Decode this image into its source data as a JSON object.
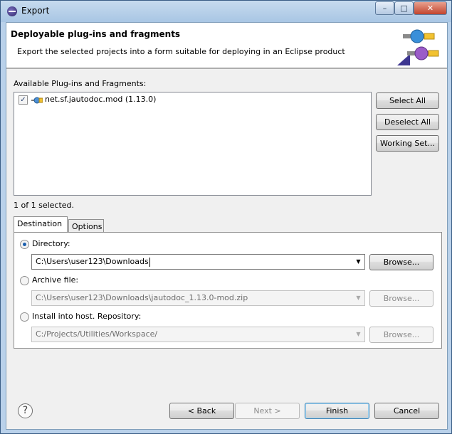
{
  "window": {
    "title": "Export"
  },
  "header": {
    "title": "Deployable plug-ins and fragments",
    "description": "Export the selected projects into a form suitable for deploying in an Eclipse product"
  },
  "plugins": {
    "label": "Available Plug-ins and Fragments:",
    "items": [
      {
        "name": "net.sf.jautodoc.mod (1.13.0)",
        "checked": true
      }
    ],
    "selection_status": "1 of 1 selected."
  },
  "side_buttons": {
    "select_all": "Select All",
    "deselect_all": "Deselect All",
    "working_set": "Working Set..."
  },
  "tabs": [
    {
      "label": "Destination",
      "active": true
    },
    {
      "label": "Options",
      "active": false
    }
  ],
  "destination": {
    "directory_label": "Directory:",
    "directory_value": "C:\\Users\\user123\\Downloads",
    "archive_label": "Archive file:",
    "archive_value": "C:\\Users\\user123\\Downloads\\jautodoc_1.13.0-mod.zip",
    "install_label": "Install into host. Repository:",
    "install_value": "C:/Projects/Utilities/Workspace/",
    "browse_label": "Browse..."
  },
  "footer": {
    "back": "< Back",
    "next": "Next >",
    "finish": "Finish",
    "cancel": "Cancel",
    "help_glyph": "?"
  }
}
